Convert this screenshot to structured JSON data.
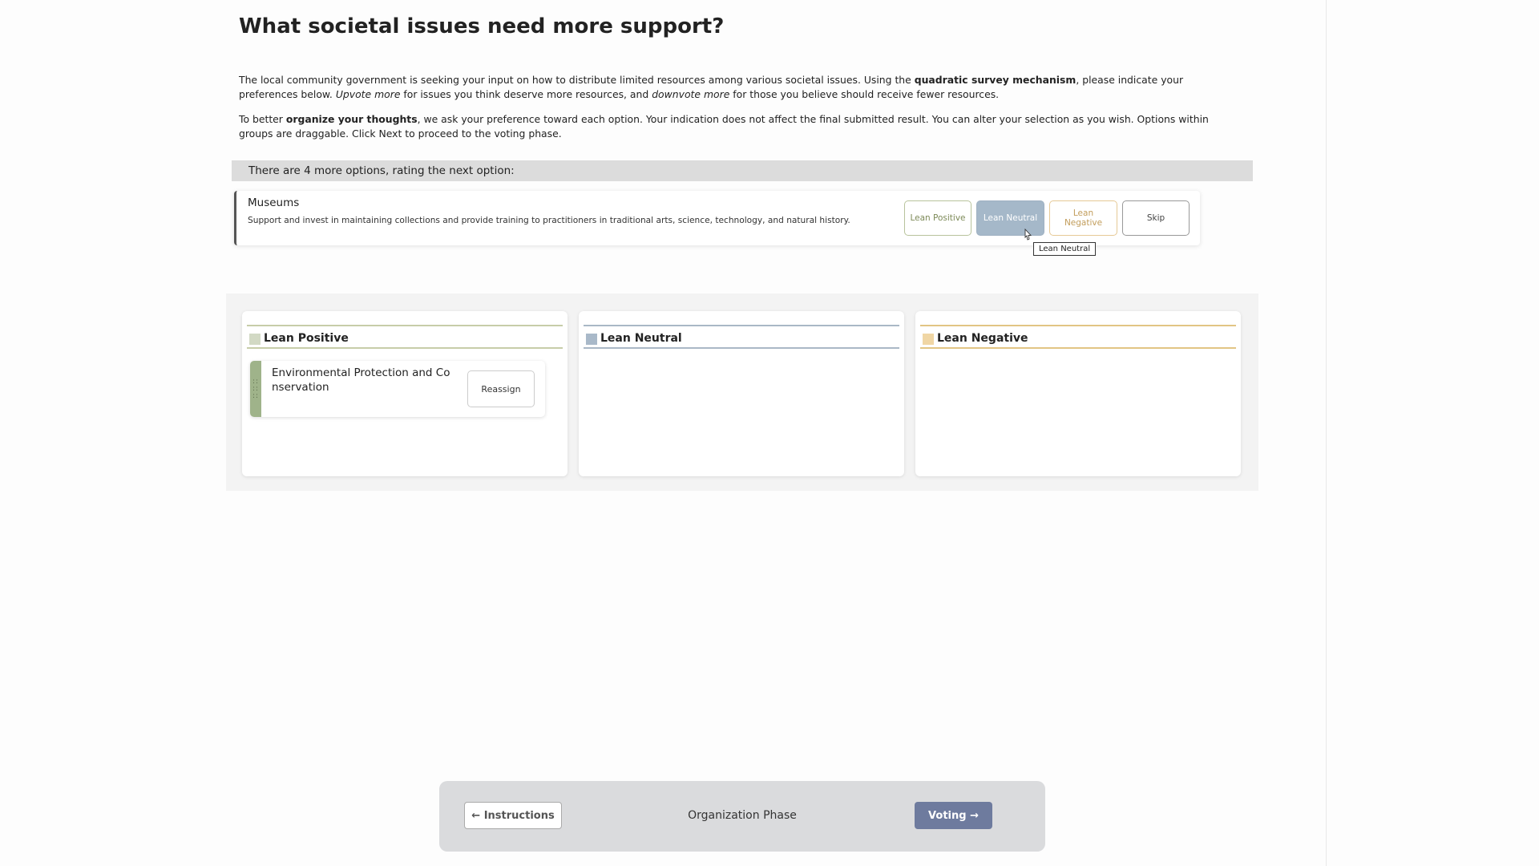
{
  "page": {
    "title": "What societal issues need more support?"
  },
  "intro": {
    "p1_a": "The local community government is seeking your input on how to distribute limited resources among various societal issues. Using the ",
    "p1_b": "quadratic survey mechanism",
    "p1_c": ", please indicate your preferences below. ",
    "p1_d": "Upvote more",
    "p1_e": " for issues you think deserve more resources, and ",
    "p1_f": "downvote more",
    "p1_g": " for those you believe should receive fewer resources.",
    "p2_a": "To better ",
    "p2_b": "organize your thoughts",
    "p2_c": ", we ask your preference toward each option. Your indication does not affect the final submitted result. You can alter your selection as you wish. Options within groups are draggable. Click Next to proceed to the voting phase."
  },
  "progress": {
    "text": "There are 4 more options, rating the next option:"
  },
  "current_option": {
    "title": "Museums",
    "description": "Support and invest in maintaining collections and provide training to practitioners in traditional arts, science, technology, and natural history.",
    "buttons": {
      "positive": "Lean Positive",
      "neutral": "Lean Neutral",
      "negative": "Lean Negative",
      "skip": "Skip"
    },
    "tooltip": "Lean Neutral"
  },
  "groups": [
    {
      "label": "Lean Positive",
      "color": "#d2d9c4",
      "items": [
        {
          "label": "Environmental Protection and Conservation",
          "action": "Reassign"
        }
      ]
    },
    {
      "label": "Lean Neutral",
      "color": "#a9b9c9",
      "items": []
    },
    {
      "label": "Lean Negative",
      "color": "#f0d6a4",
      "items": []
    }
  ],
  "footer": {
    "prev_label": "← Instructions",
    "phase_label": "Organization Phase",
    "next_label": "Voting →"
  }
}
